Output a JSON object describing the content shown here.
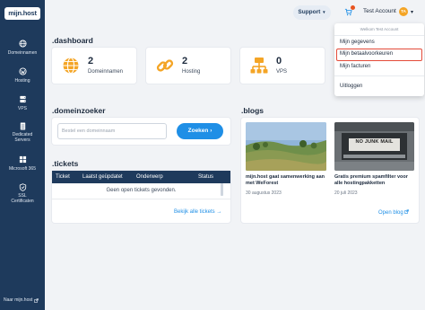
{
  "brand": {
    "logo": "mijn.host"
  },
  "sidebar": {
    "items": [
      {
        "label": "Domeinnamen",
        "icon": "globe-icon"
      },
      {
        "label": "Hosting",
        "icon": "wordpress-icon"
      },
      {
        "label": "VPS",
        "icon": "server-icon"
      },
      {
        "label": "Dedicated Servers",
        "icon": "server-rack-icon"
      },
      {
        "label": "Microsoft 365",
        "icon": "microsoft-icon"
      },
      {
        "label": "SSL Certificaten",
        "icon": "shield-icon"
      }
    ],
    "footer": "Naar mijn.host"
  },
  "topbar": {
    "support": "Support",
    "account": "Test Account",
    "avatar_initials": "TA",
    "cart_badge_color": "#e8541f"
  },
  "dashboard": {
    "title": ".dashboard",
    "stats": [
      {
        "value": "2",
        "label": "Domeinnamen",
        "icon": "globe-icon"
      },
      {
        "value": "2",
        "label": "Hosting",
        "icon": "link-icon"
      },
      {
        "value": "0",
        "label": "VPS",
        "icon": "network-icon"
      }
    ]
  },
  "domainsearch": {
    "title": ".domeinzoeker",
    "placeholder": "Bestel een domeinnaam",
    "button": "Zoeken"
  },
  "tickets": {
    "title": ".tickets",
    "columns": [
      "Ticket",
      "Laatst geüpdatet",
      "Onderwerp",
      "Status"
    ],
    "empty": "Geen open tickets gevonden.",
    "link": "Bekijk alle tickets"
  },
  "blogs": {
    "title": ".blogs",
    "posts": [
      {
        "title": "mijn.host gaat samenwerking aan met WeForest",
        "date": "30 augustus 2023"
      },
      {
        "title": "Gratis premium spamfilter voor alle hostingpakketten",
        "date": "20 juli 2023"
      }
    ],
    "link": "Open blog",
    "sign_text": "NO JUNK MAIL"
  },
  "dropdown": {
    "header": "Welkom Test Account",
    "items": [
      "Mijn gegevens",
      "Mijn betaalvoorkeuren",
      "Mijn facturen",
      "Uitloggen"
    ]
  },
  "colors": {
    "sidebar": "#1e3a5c",
    "accent": "#1f8fe6",
    "stat_icon": "#f4a526",
    "highlight": "#e44b3a"
  }
}
